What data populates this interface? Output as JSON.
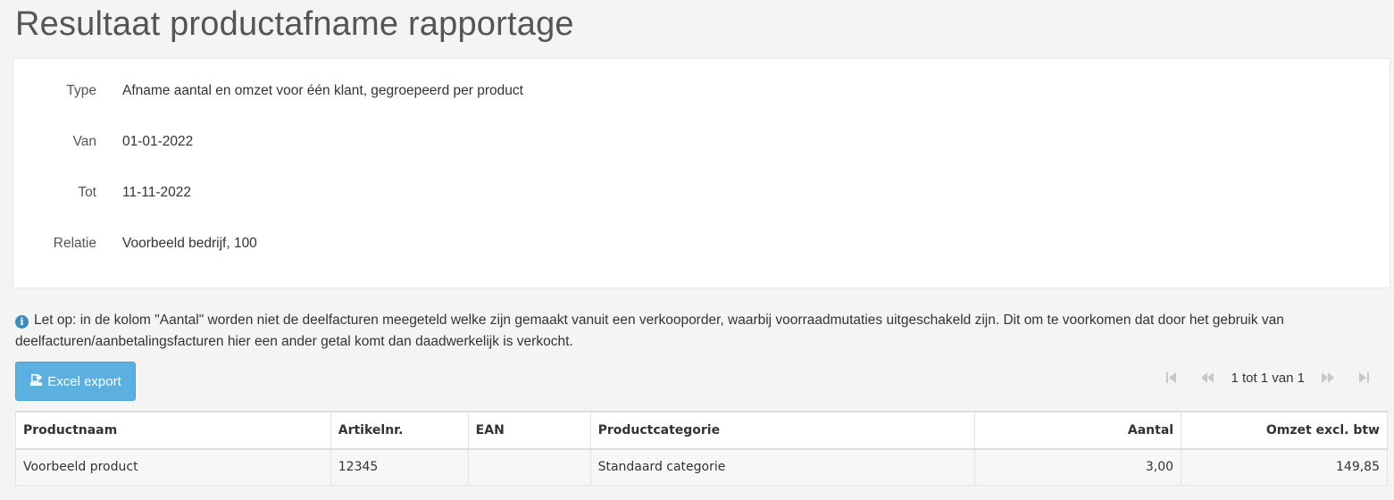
{
  "page": {
    "title": "Resultaat productafname rapportage"
  },
  "summary": {
    "type_label": "Type",
    "type_value": "Afname aantal en omzet voor één klant, gegroepeerd per product",
    "from_label": "Van",
    "from_value": "01-01-2022",
    "to_label": "Tot",
    "to_value": "11-11-2022",
    "relation_label": "Relatie",
    "relation_value": "Voorbeeld bedrijf, 100"
  },
  "notice": {
    "icon": "info-icon",
    "text": "Let op: in de kolom \"Aantal\" worden niet de deelfacturen meegeteld welke zijn gemaakt vanuit een verkooporder, waarbij voorraadmutaties uitgeschakeld zijn. Dit om te voorkomen dat door het gebruik van deelfacturen/aanbetalingsfacturen hier een ander getal komt dan daadwerkelijk is verkocht."
  },
  "toolbar": {
    "excel_label": "Excel export",
    "excel_icon": "excel-export-icon"
  },
  "pager": {
    "text": "1 tot 1 van 1",
    "icons": [
      "first-page-icon",
      "previous-page-icon",
      "next-page-icon",
      "last-page-icon"
    ]
  },
  "table": {
    "headers": [
      "Productnaam",
      "Artikelnr.",
      "EAN",
      "Productcategorie",
      "Aantal",
      "Omzet excl. btw"
    ],
    "rows": [
      [
        "Voorbeeld product",
        "12345",
        "",
        "Standaard categorie",
        "3,00",
        "149,85"
      ]
    ]
  },
  "colors": {
    "button": "#5bb0df",
    "info_icon": "#3c8dbc",
    "background": "#f4f4f4"
  }
}
